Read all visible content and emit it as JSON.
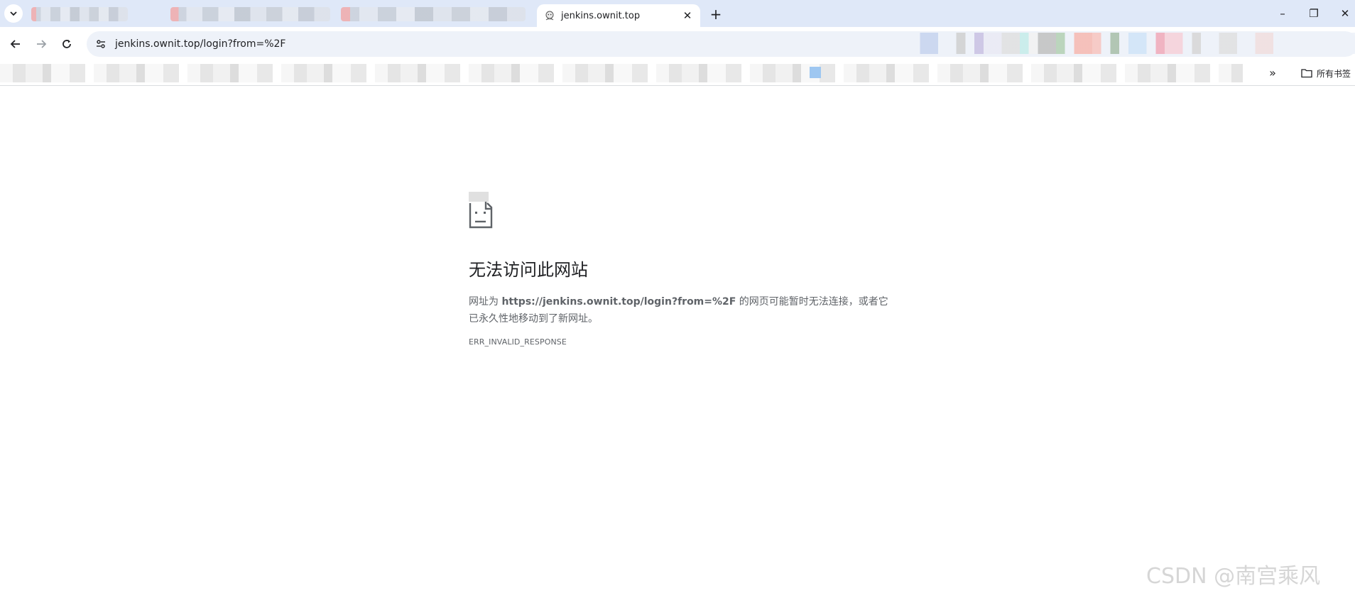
{
  "browser": {
    "active_tab": {
      "title": "jenkins.ownit.top",
      "close_glyph": "✕"
    },
    "new_tab_glyph": "+",
    "window_controls": {
      "minimize": "–",
      "restore": "❐",
      "close": "✕"
    },
    "address": {
      "url": "jenkins.ownit.top/login?from=%2F"
    },
    "bookmarks_bar": {
      "more_glyph": "»",
      "all_bookmarks": "所有书签"
    },
    "icons": [
      "tab-search-icon",
      "site-favicon-icon",
      "back-icon",
      "forward-icon",
      "reload-icon",
      "site-info-icon",
      "folder-icon"
    ]
  },
  "error_page": {
    "title": "无法访问此网站",
    "desc_prefix": "网址为 ",
    "desc_url": "https://jenkins.ownit.top/login?from=%2F",
    "desc_suffix": " 的网页可能暂时无法连接，或者它已永久性地移动到了新网址。",
    "error_code": "ERR_INVALID_RESPONSE"
  },
  "watermark": "CSDN @南宫乘风"
}
